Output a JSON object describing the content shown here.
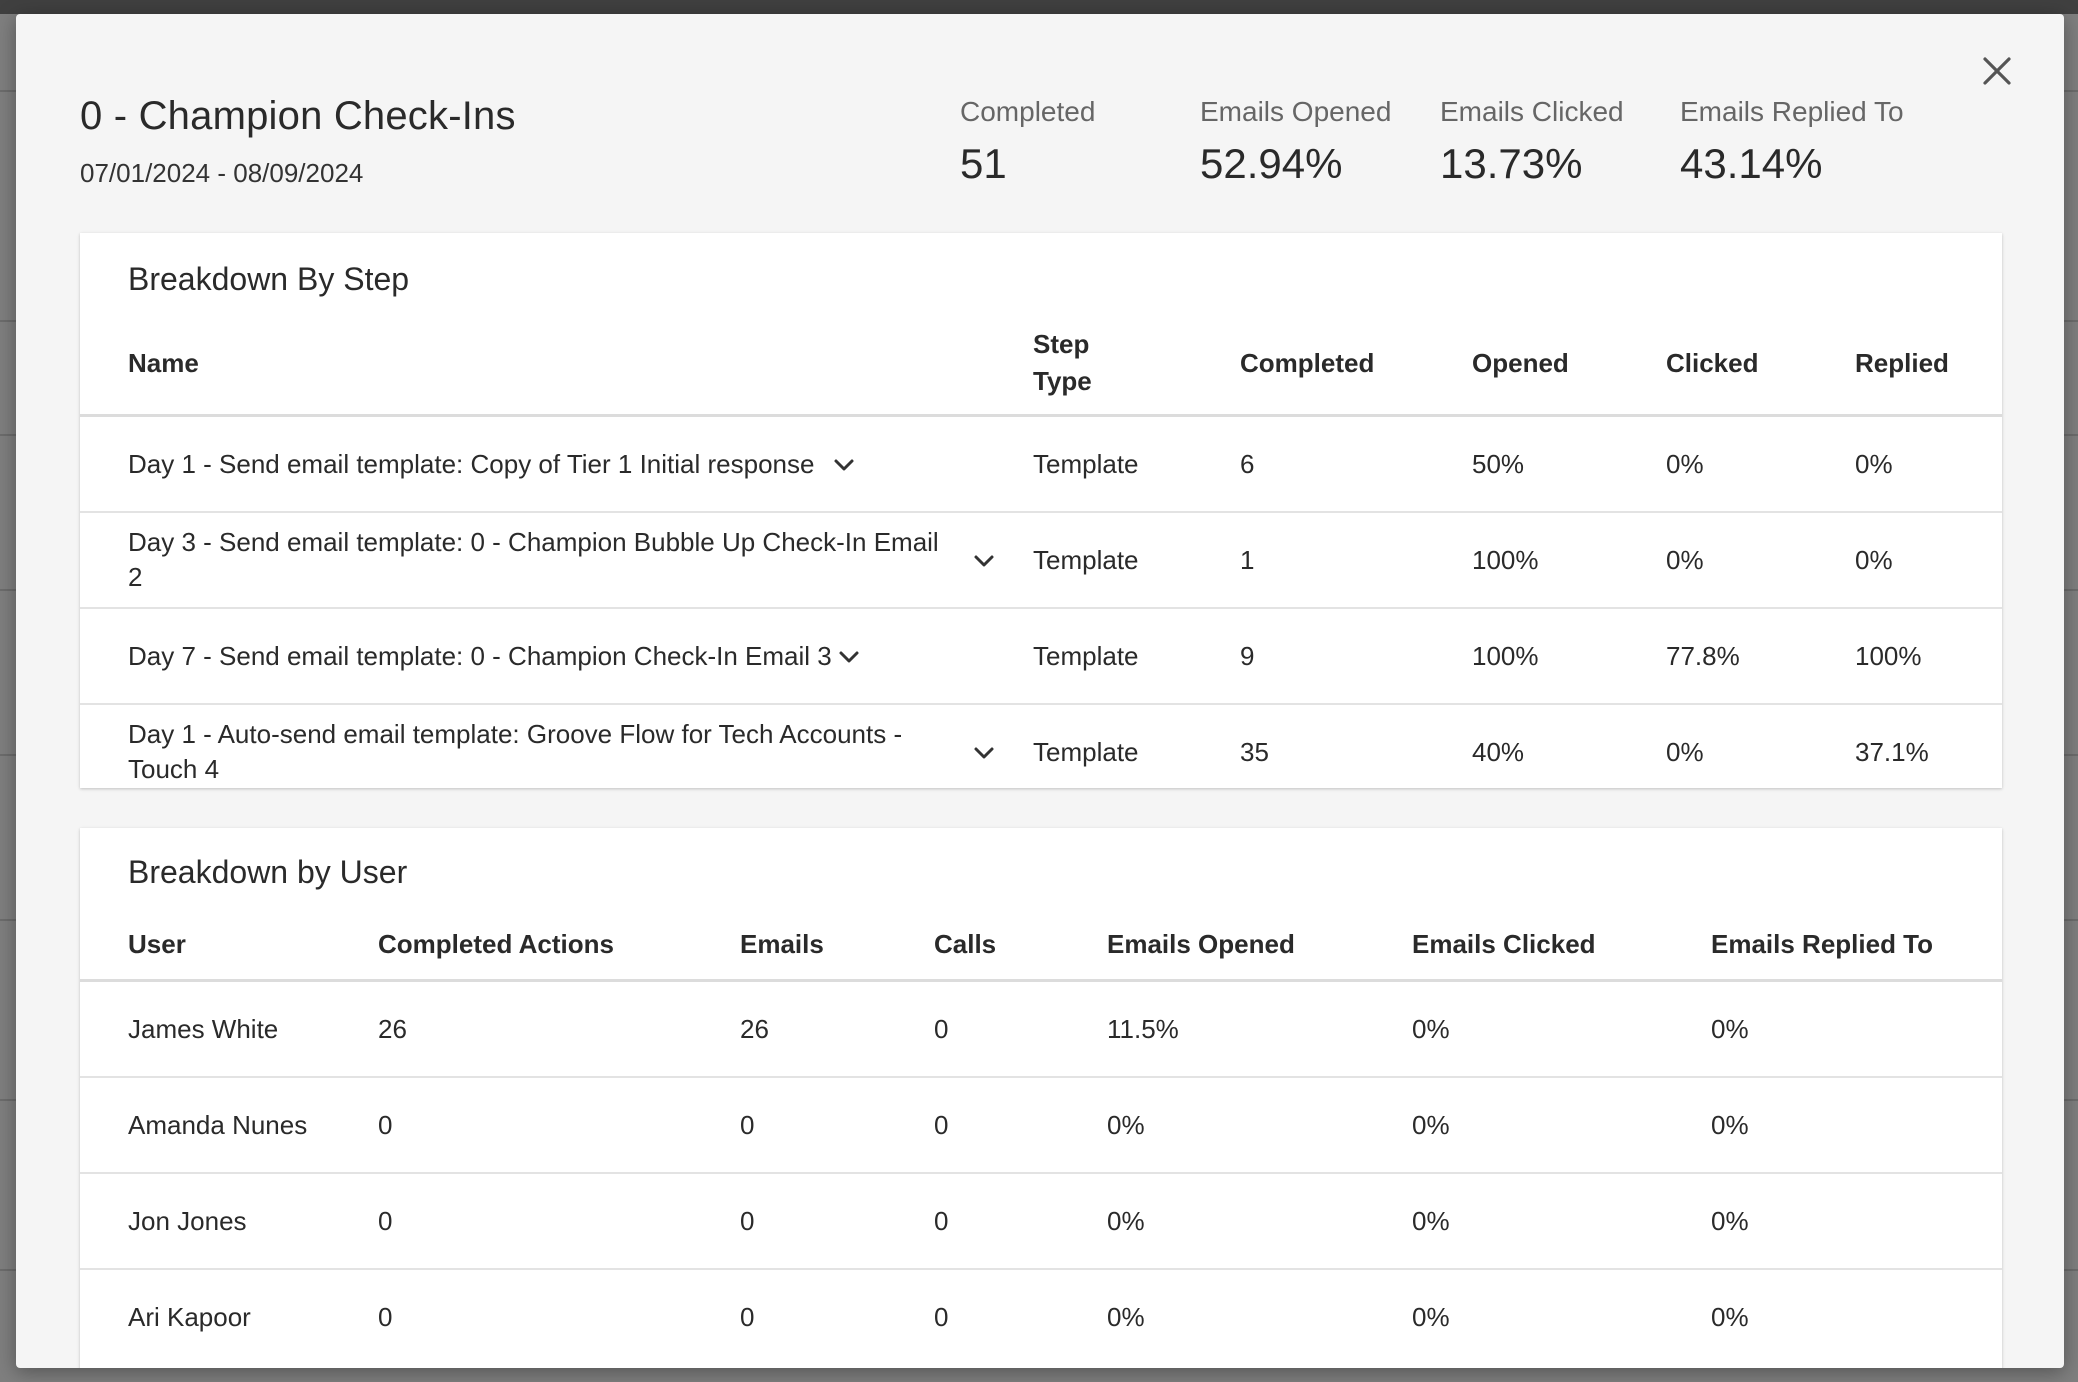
{
  "modal": {
    "title": "0 - Champion Check-Ins",
    "date_range": "07/01/2024 - 08/09/2024",
    "close_icon": "close-icon",
    "stats": [
      {
        "label": "Completed",
        "value": "51"
      },
      {
        "label": "Emails Opened",
        "value": "52.94%"
      },
      {
        "label": "Emails Clicked",
        "value": "13.73%"
      },
      {
        "label": "Emails Replied To",
        "value": "43.14%"
      }
    ]
  },
  "steps": {
    "title": "Breakdown By Step",
    "headers": {
      "name": "Name",
      "step_type_line1": "Step",
      "step_type_line2": "Type",
      "completed": "Completed",
      "opened": "Opened",
      "clicked": "Clicked",
      "replied": "Replied"
    },
    "rows": [
      {
        "name": "Day 1 - Send email template: Copy of Tier 1 Initial response",
        "type": "Template",
        "completed": "6",
        "opened": "50%",
        "clicked": "0%",
        "replied": "0%"
      },
      {
        "name": "Day 3 - Send email template: 0 - Champion Bubble Up Check-In Email 2",
        "type": "Template",
        "completed": "1",
        "opened": "100%",
        "clicked": "0%",
        "replied": "0%"
      },
      {
        "name": "Day 7 - Send email template: 0 - Champion Check-In Email 3",
        "type": "Template",
        "completed": "9",
        "opened": "100%",
        "clicked": "77.8%",
        "replied": "100%"
      },
      {
        "name": "Day 1 - Auto-send email template: Groove Flow for Tech Accounts - Touch 4",
        "type": "Template",
        "completed": "35",
        "opened": "40%",
        "clicked": "0%",
        "replied": "37.1%"
      }
    ],
    "expand_icon": "chevron-down-icon"
  },
  "users": {
    "title": "Breakdown by User",
    "headers": {
      "user": "User",
      "completed_actions": "Completed Actions",
      "emails": "Emails",
      "calls": "Calls",
      "emails_opened": "Emails Opened",
      "emails_clicked": "Emails Clicked",
      "emails_replied": "Emails Replied To"
    },
    "rows": [
      {
        "user": "James White",
        "completed_actions": "26",
        "emails": "26",
        "calls": "0",
        "emails_opened": "11.5%",
        "emails_clicked": "0%",
        "emails_replied": "0%"
      },
      {
        "user": "Amanda Nunes",
        "completed_actions": "0",
        "emails": "0",
        "calls": "0",
        "emails_opened": "0%",
        "emails_clicked": "0%",
        "emails_replied": "0%"
      },
      {
        "user": "Jon Jones",
        "completed_actions": "0",
        "emails": "0",
        "calls": "0",
        "emails_opened": "0%",
        "emails_clicked": "0%",
        "emails_replied": "0%"
      },
      {
        "user": "Ari Kapoor",
        "completed_actions": "0",
        "emails": "0",
        "calls": "0",
        "emails_opened": "0%",
        "emails_clicked": "0%",
        "emails_replied": "0%"
      }
    ]
  }
}
